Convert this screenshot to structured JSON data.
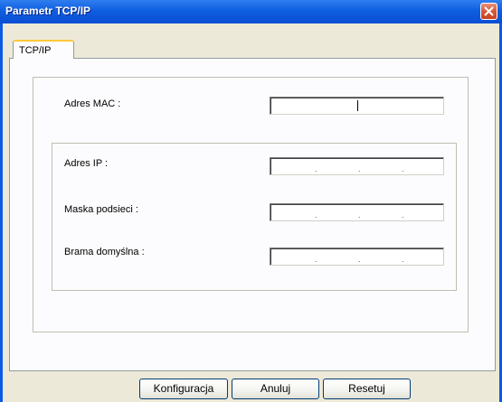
{
  "window": {
    "title": "Parametr TCP/IP"
  },
  "tabs": [
    {
      "label": "TCP/IP"
    }
  ],
  "mac": {
    "label": "Adres MAC :",
    "value": ""
  },
  "ip": {
    "label": "Adres IP :",
    "separators": [
      ".",
      ".",
      "."
    ]
  },
  "mask": {
    "label": "Maska podsieci :",
    "separators": [
      ".",
      ".",
      "."
    ]
  },
  "gateway": {
    "label": "Brama domyślna :",
    "separators": [
      ".",
      ".",
      "."
    ]
  },
  "buttons": {
    "configure": "Konfiguracja",
    "cancel": "Anuluj",
    "reset": "Resetuj"
  },
  "colors": {
    "titlebar": "#0a5ae6",
    "tab_accent": "#ffc83c",
    "close": "#d6573a"
  },
  "icons": {
    "close": "close-icon"
  }
}
